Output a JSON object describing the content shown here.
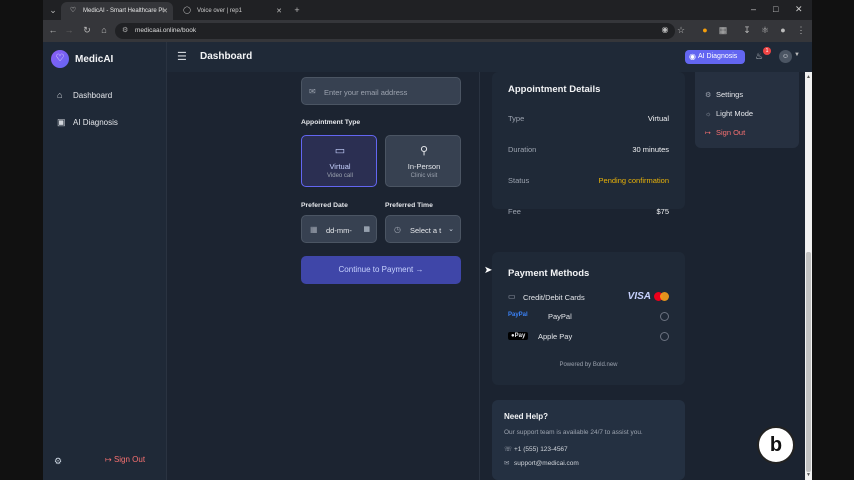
{
  "browser": {
    "tabs": [
      {
        "title": "MedicAI - Smart Healthcare Pl",
        "active": true
      },
      {
        "title": "Voice over | rep1",
        "active": false
      }
    ],
    "url": "medicaai.online/book"
  },
  "sidebar": {
    "brand": "MedicAI",
    "items": [
      {
        "label": "Dashboard",
        "icon": "home-icon"
      },
      {
        "label": "AI Diagnosis",
        "icon": "diagnosis-icon"
      }
    ],
    "sign_out": "Sign Out"
  },
  "topbar": {
    "title": "Dashboard",
    "ai_button": "AI Diagnosis",
    "notifications_count": "1"
  },
  "form": {
    "email_placeholder": "Enter your email address",
    "appointment_type_label": "Appointment Type",
    "options": [
      {
        "title": "Virtual",
        "subtitle": "Video call",
        "selected": true
      },
      {
        "title": "In-Person",
        "subtitle": "Clinic visit",
        "selected": false
      }
    ],
    "preferred_date_label": "Preferred Date",
    "preferred_time_label": "Preferred Time",
    "date_value": "dd-mm-",
    "time_value": "Select a t",
    "continue_button": "Continue to Payment →"
  },
  "appointment_details": {
    "title": "Appointment Details",
    "rows": [
      {
        "key": "Type",
        "value": "Virtual"
      },
      {
        "key": "Duration",
        "value": "30 minutes"
      },
      {
        "key": "Status",
        "value": "Pending confirmation"
      },
      {
        "key": "Fee",
        "value": "$75"
      }
    ]
  },
  "payment_methods": {
    "title": "Payment Methods",
    "methods": [
      {
        "label": "Credit/Debit Cards",
        "brand": "VISA"
      },
      {
        "label": "PayPal",
        "brand": "PayPal"
      },
      {
        "label": "Apple Pay",
        "brand": "Pay"
      }
    ],
    "powered_by": "Powered by Bold.new"
  },
  "help": {
    "title": "Need Help?",
    "text": "Our support team is available 24/7 to assist you.",
    "phone": "+1 (555) 123-4567",
    "email": "support@medicai.com"
  },
  "user_menu": {
    "items": [
      {
        "label": "Settings",
        "icon": "gear-icon"
      },
      {
        "label": "Light Mode",
        "icon": "sun-icon"
      },
      {
        "label": "Sign Out",
        "icon": "sign-out-icon"
      }
    ]
  },
  "colors": {
    "accent": "#6366f1",
    "pending": "#eab308",
    "danger": "#f87171"
  }
}
